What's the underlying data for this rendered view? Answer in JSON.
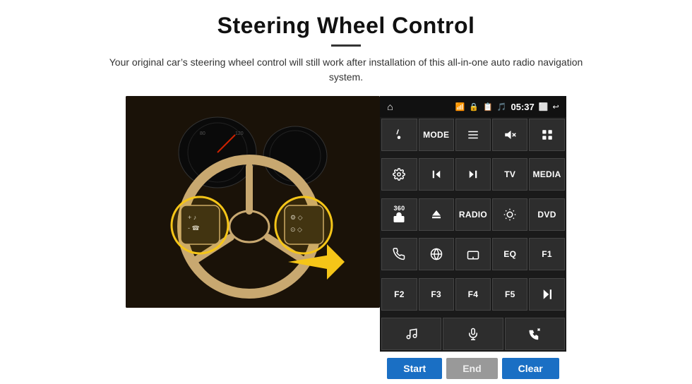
{
  "header": {
    "title": "Steering Wheel Control",
    "subtitle": "Your original car’s steering wheel control will still work after installation of this all-in-one auto radio navigation system."
  },
  "status_bar": {
    "time": "05:37"
  },
  "control_buttons": [
    {
      "id": "row1",
      "buttons": [
        {
          "label": "",
          "icon": "nav-icon",
          "type": "icon"
        },
        {
          "label": "MODE",
          "icon": "",
          "type": "text"
        },
        {
          "label": "",
          "icon": "list-icon",
          "type": "icon"
        },
        {
          "label": "",
          "icon": "mute-icon",
          "type": "icon"
        },
        {
          "label": "",
          "icon": "grid-icon",
          "type": "icon"
        }
      ]
    },
    {
      "id": "row2",
      "buttons": [
        {
          "label": "",
          "icon": "settings-icon",
          "type": "icon"
        },
        {
          "label": "",
          "icon": "prev-icon",
          "type": "icon"
        },
        {
          "label": "",
          "icon": "next-icon",
          "type": "icon"
        },
        {
          "label": "TV",
          "icon": "",
          "type": "text"
        },
        {
          "label": "MEDIA",
          "icon": "",
          "type": "text"
        }
      ]
    },
    {
      "id": "row3",
      "buttons": [
        {
          "label": "360",
          "icon": "360-icon",
          "type": "icon-text"
        },
        {
          "label": "",
          "icon": "eject-icon",
          "type": "icon"
        },
        {
          "label": "RADIO",
          "icon": "",
          "type": "text"
        },
        {
          "label": "",
          "icon": "brightness-icon",
          "type": "icon"
        },
        {
          "label": "DVD",
          "icon": "",
          "type": "text"
        }
      ]
    },
    {
      "id": "row4",
      "buttons": [
        {
          "label": "",
          "icon": "phone-icon",
          "type": "icon"
        },
        {
          "label": "",
          "icon": "browser-icon",
          "type": "icon"
        },
        {
          "label": "",
          "icon": "screen-icon",
          "type": "icon"
        },
        {
          "label": "EQ",
          "icon": "",
          "type": "text"
        },
        {
          "label": "F1",
          "icon": "",
          "type": "text"
        }
      ]
    },
    {
      "id": "row5",
      "buttons": [
        {
          "label": "F2",
          "icon": "",
          "type": "text"
        },
        {
          "label": "F3",
          "icon": "",
          "type": "text"
        },
        {
          "label": "F4",
          "icon": "",
          "type": "text"
        },
        {
          "label": "F5",
          "icon": "",
          "type": "text"
        },
        {
          "label": "",
          "icon": "play-pause-icon",
          "type": "icon"
        }
      ]
    }
  ],
  "bottom_buttons": [
    {
      "label": "",
      "icon": "music-icon",
      "type": "icon"
    },
    {
      "label": "",
      "icon": "mic-icon",
      "type": "icon"
    },
    {
      "label": "",
      "icon": "phone-end-icon",
      "type": "icon"
    }
  ],
  "action_bar": {
    "start_label": "Start",
    "end_label": "End",
    "clear_label": "Clear"
  }
}
